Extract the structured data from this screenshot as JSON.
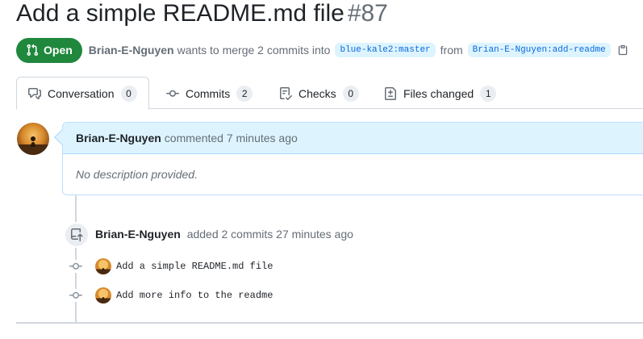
{
  "pull_request": {
    "title": "Add a simple README.md file",
    "number": "#87",
    "state": "Open",
    "author": "Brian-E-Nguyen",
    "merge_text": "wants to merge 2 commits into",
    "base_branch": "blue-kale2:master",
    "from_text": "from",
    "head_branch": "Brian-E-Nguyen:add-readme"
  },
  "tabs": [
    {
      "label": "Conversation",
      "count": "0",
      "icon": "comment-discussion-icon",
      "selected": true
    },
    {
      "label": "Commits",
      "count": "2",
      "icon": "git-commit-icon",
      "selected": false
    },
    {
      "label": "Checks",
      "count": "0",
      "icon": "checklist-icon",
      "selected": false
    },
    {
      "label": "Files changed",
      "count": "1",
      "icon": "file-diff-icon",
      "selected": false
    }
  ],
  "comment": {
    "author": "Brian-E-Nguyen",
    "meta": "commented 7 minutes ago",
    "body": "No description provided."
  },
  "event": {
    "author": "Brian-E-Nguyen",
    "text": "added 2 commits 27 minutes ago",
    "icon": "repo-push-icon"
  },
  "commits": [
    {
      "message": "Add a simple README.md file"
    },
    {
      "message": "Add more info to the readme"
    }
  ],
  "colors": {
    "open_green": "#1f883d",
    "link_blue": "#0969da",
    "comment_header_bg": "#ddf4ff"
  }
}
